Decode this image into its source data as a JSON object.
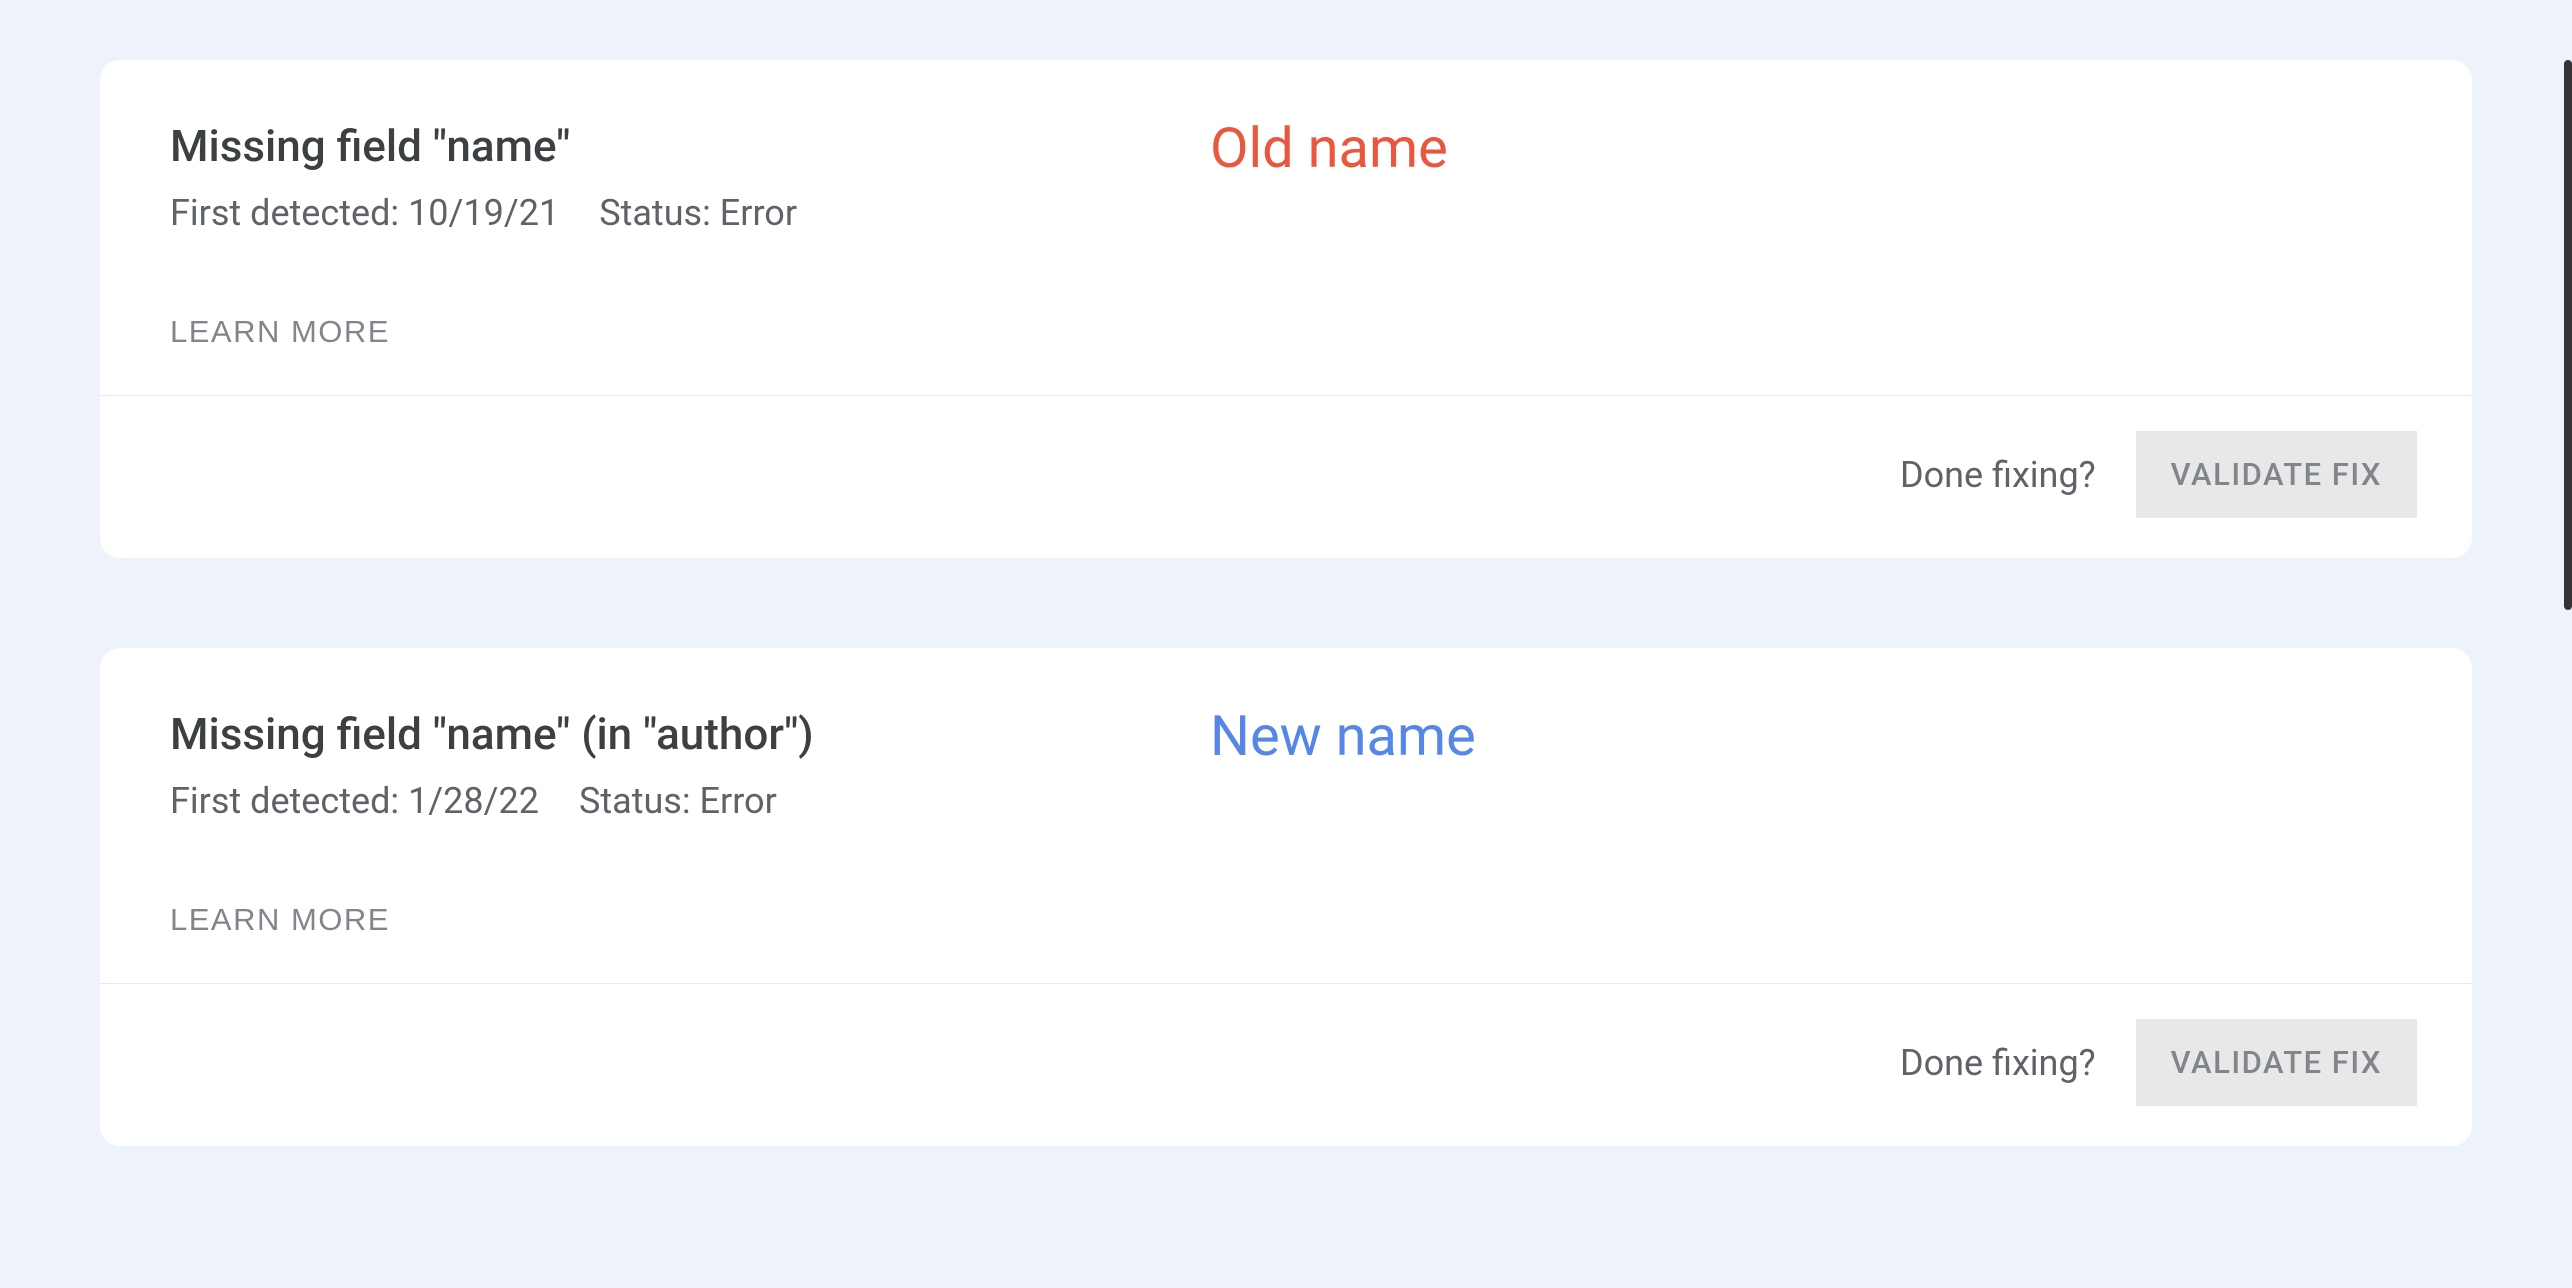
{
  "cards": [
    {
      "title": "Missing field \"name\"",
      "first_detected_label": "First detected:",
      "first_detected_value": "10/19/21",
      "status_label": "Status:",
      "status_value": "Error",
      "learn_more": "LEARN MORE",
      "annotation": "Old name",
      "done_fixing": "Done fixing?",
      "validate_fix": "VALIDATE FIX"
    },
    {
      "title": "Missing field \"name\" (in \"author\")",
      "first_detected_label": "First detected:",
      "first_detected_value": "1/28/22",
      "status_label": "Status:",
      "status_value": "Error",
      "learn_more": "LEARN MORE",
      "annotation": "New name",
      "done_fixing": "Done fixing?",
      "validate_fix": "VALIDATE FIX"
    }
  ]
}
